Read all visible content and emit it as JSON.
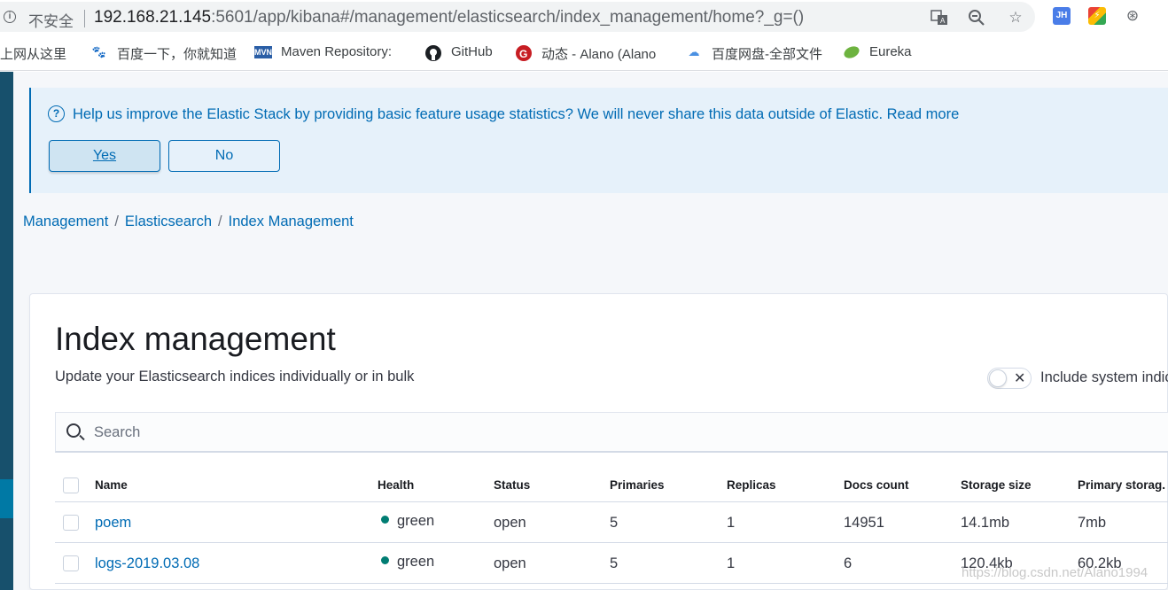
{
  "browser": {
    "security_label": "不安全",
    "url_host": "192.168.21.145",
    "url_rest": ":5601/app/kibana#/management/elasticsearch/index_management/home?_g=()",
    "bookmarks": [
      {
        "label": "上网从这里",
        "icon": "globe-icon"
      },
      {
        "label": "百度一下，你就知道",
        "icon": "baidu-paw-icon"
      },
      {
        "label": "Maven Repository:",
        "icon": "mvn-icon"
      },
      {
        "label": "GitHub",
        "icon": "github-icon"
      },
      {
        "label": "动态 - Alano (Alano",
        "icon": "gitee-icon"
      },
      {
        "label": "百度网盘-全部文件",
        "icon": "baidu-pan-icon"
      },
      {
        "label": "Eureka",
        "icon": "leaf-icon"
      }
    ],
    "ext_jh": "JH"
  },
  "callout": {
    "text": "Help us improve the Elastic Stack by providing basic feature usage statistics? We will never share this data outside of Elastic. Read more",
    "yes_label": "Yes",
    "no_label": "No"
  },
  "breadcrumbs": [
    "Management",
    "Elasticsearch",
    "Index Management"
  ],
  "page": {
    "title": "Index management",
    "description": "Update your Elasticsearch indices individually or in bulk",
    "toggle_label": "Include system indic",
    "toggle_on": false,
    "search_placeholder": "Search"
  },
  "table": {
    "columns": [
      "Name",
      "Health",
      "Status",
      "Primaries",
      "Replicas",
      "Docs count",
      "Storage size",
      "Primary storag."
    ],
    "rows": [
      {
        "name": "poem",
        "health": "green",
        "status": "open",
        "primaries": "5",
        "replicas": "1",
        "docs_count": "14951",
        "storage_size": "14.1mb",
        "primary_storage": "7mb"
      },
      {
        "name": "logs-2019.03.08",
        "health": "green",
        "status": "open",
        "primaries": "5",
        "replicas": "1",
        "docs_count": "6",
        "storage_size": "120.4kb",
        "primary_storage": "60.2kb"
      }
    ]
  },
  "colors": {
    "accent": "#006bb4",
    "health_green": "#017d73",
    "rail": "#17506c"
  },
  "watermark": "https://blog.csdn.net/Alano1994"
}
